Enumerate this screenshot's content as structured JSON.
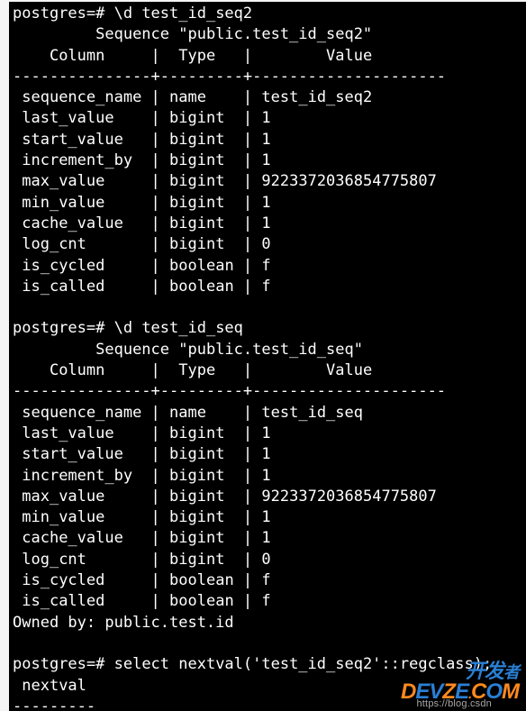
{
  "prompt": "postgres=#",
  "commands": {
    "d_seq2": "\\d test_id_seq2",
    "d_seq": "\\d test_id_seq",
    "select": "select nextval('test_id_seq2'::regclass);"
  },
  "headers": {
    "column": "Column",
    "type": "Type",
    "value": "Value"
  },
  "seq2": {
    "title": "Sequence \"public.test_id_seq2\"",
    "rows": [
      {
        "col": "sequence_name",
        "type": "name",
        "value": "test_id_seq2"
      },
      {
        "col": "last_value",
        "type": "bigint",
        "value": "1"
      },
      {
        "col": "start_value",
        "type": "bigint",
        "value": "1"
      },
      {
        "col": "increment_by",
        "type": "bigint",
        "value": "1"
      },
      {
        "col": "max_value",
        "type": "bigint",
        "value": "9223372036854775807"
      },
      {
        "col": "min_value",
        "type": "bigint",
        "value": "1"
      },
      {
        "col": "cache_value",
        "type": "bigint",
        "value": "1"
      },
      {
        "col": "log_cnt",
        "type": "bigint",
        "value": "0"
      },
      {
        "col": "is_cycled",
        "type": "boolean",
        "value": "f"
      },
      {
        "col": "is_called",
        "type": "boolean",
        "value": "f"
      }
    ]
  },
  "seq": {
    "title": "Sequence \"public.test_id_seq\"",
    "rows": [
      {
        "col": "sequence_name",
        "type": "name",
        "value": "test_id_seq"
      },
      {
        "col": "last_value",
        "type": "bigint",
        "value": "1"
      },
      {
        "col": "start_value",
        "type": "bigint",
        "value": "1"
      },
      {
        "col": "increment_by",
        "type": "bigint",
        "value": "1"
      },
      {
        "col": "max_value",
        "type": "bigint",
        "value": "9223372036854775807"
      },
      {
        "col": "min_value",
        "type": "bigint",
        "value": "1"
      },
      {
        "col": "cache_value",
        "type": "bigint",
        "value": "1"
      },
      {
        "col": "log_cnt",
        "type": "bigint",
        "value": "0"
      },
      {
        "col": "is_cycled",
        "type": "boolean",
        "value": "f"
      },
      {
        "col": "is_called",
        "type": "boolean",
        "value": "f"
      }
    ],
    "owned_by": "Owned by: public.test.id"
  },
  "result": {
    "header": "nextval",
    "dashes": "---------"
  },
  "watermark": {
    "url": "https://blog.csdn",
    "logo1": "开发",
    "logo2": "D",
    "logo3": "EV",
    "logo4": "Z",
    "logo5": "E",
    "logo6": ".",
    "logo7": "C",
    "logo8": "O",
    "logo9": "M"
  }
}
